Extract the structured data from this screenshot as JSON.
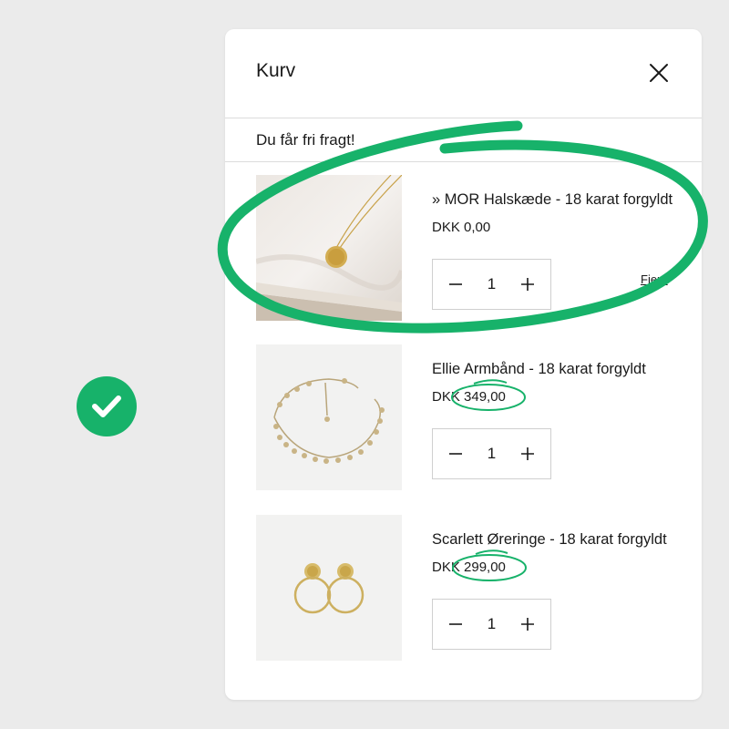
{
  "cart": {
    "title": "Kurv",
    "banner": "Du får fri fragt!",
    "remove_label": "Fjern",
    "items": [
      {
        "name": "» MOR Halskæde - 18 karat forgyldt",
        "price": "DKK 0,00",
        "quantity": "1"
      },
      {
        "name": "Ellie Armbånd - 18 karat forgyldt",
        "price": "DKK 349,00",
        "quantity": "1"
      },
      {
        "name": "Scarlett Øreringe - 18 karat forgyldt",
        "price": "DKK 299,00",
        "quantity": "1"
      }
    ]
  },
  "icons": {
    "check": "check-icon",
    "close": "close-icon",
    "minus": "minus-icon",
    "plus": "plus-icon"
  },
  "colors": {
    "accent": "#17b26a",
    "background": "#ebebeb",
    "panel": "#ffffff"
  }
}
